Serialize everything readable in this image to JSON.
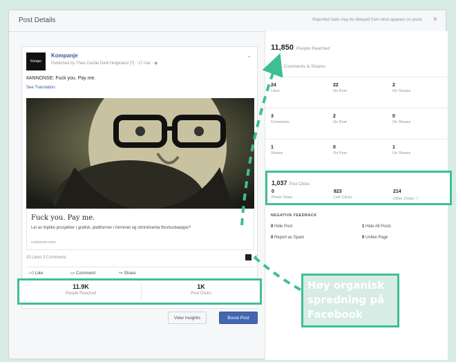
{
  "dialog": {
    "title": "Post Details",
    "note": "Reported stats may be delayed from what appears on posts",
    "close_icon": "×"
  },
  "post": {
    "avatar_text": "Kompo",
    "page_name": "Kompanje",
    "published": "Published by Thea Cecilie Dahl Helgeland [?] · 17 mai · ◉",
    "text": "#ANNONSE: Fuck you. Pay me.",
    "see_translation": "See Translation",
    "link_title": "Fuck you. Pay me.",
    "link_desc": "Lei av triplike prosjekter i grafisk, plattformer i formmet og utmmilsertia fbruitusbaeppe?",
    "link_domain": "coolsnum.com",
    "likes_comments": "33 Likes  3 Comments",
    "actions": [
      "Like",
      "Comment",
      "Share"
    ],
    "stats": [
      {
        "value": "11.9K",
        "label": "People Reached"
      },
      {
        "value": "1K",
        "label": "Post Clicks"
      }
    ],
    "buttons": {
      "insights": "View Insights",
      "boost": "Boost Post"
    }
  },
  "insights": {
    "reach_value": "11,850",
    "reach_label": "People Reached",
    "lcs_label": "Likes, Comments & Shares",
    "grid": [
      [
        {
          "v": "24",
          "l": "Likes"
        },
        {
          "v": "22",
          "l": "On Post"
        },
        {
          "v": "2",
          "l": "On Shares"
        }
      ],
      [
        {
          "v": "3",
          "l": "Comments"
        },
        {
          "v": "2",
          "l": "On Post"
        },
        {
          "v": "0",
          "l": "On Shares"
        }
      ],
      [
        {
          "v": "1",
          "l": "Shares"
        },
        {
          "v": "0",
          "l": "On Post"
        },
        {
          "v": "1",
          "l": "On Shares"
        }
      ]
    ],
    "clicks_value": "1,037",
    "clicks_label": "Post Clicks",
    "clicks": [
      {
        "v": "0",
        "l": "Photo Views"
      },
      {
        "v": "823",
        "l": "Link Clicks"
      },
      {
        "v": "214",
        "l": "Other Clicks ⓘ"
      }
    ],
    "negative_title": "NEGATIVE FEEDBACK",
    "negative": [
      {
        "v": "0",
        "l": "Hide Post"
      },
      {
        "v": "1",
        "l": "Hide All Posts"
      },
      {
        "v": "0",
        "l": "Report as Spam"
      },
      {
        "v": "0",
        "l": "Unlike Page"
      }
    ]
  },
  "callout": {
    "lines": [
      "Høy organisk",
      "spredning på",
      "Facebook"
    ]
  },
  "colors": {
    "highlight": "#3fbf8f",
    "boost": "#4267b2",
    "link": "#365899"
  }
}
